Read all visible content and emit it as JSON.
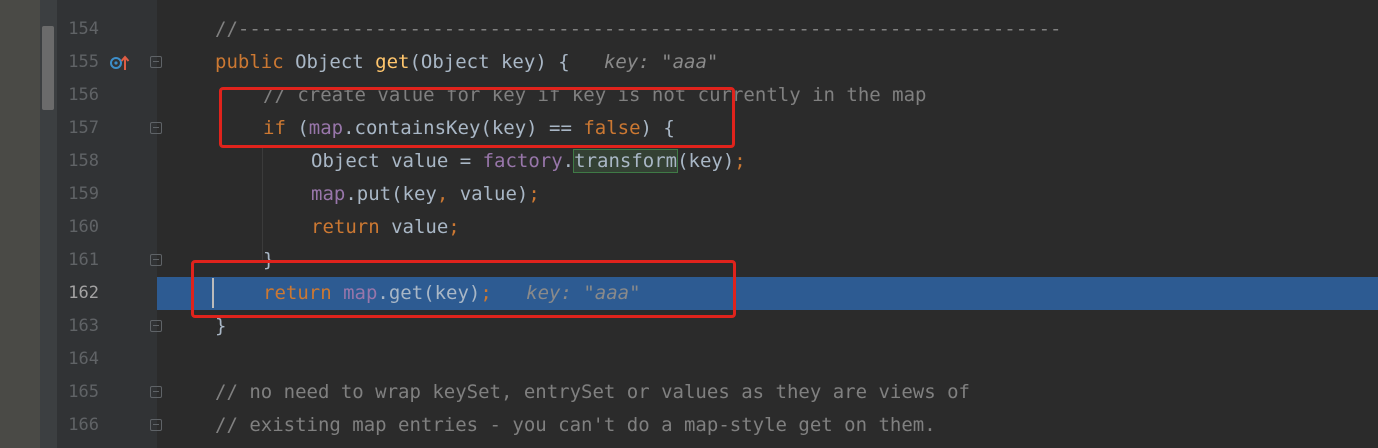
{
  "gutter": {
    "line_numbers": [
      "154",
      "155",
      "156",
      "157",
      "158",
      "159",
      "160",
      "161",
      "162",
      "163",
      "164",
      "165",
      "166"
    ]
  },
  "code": {
    "l154": "//------------------------------------------------------------------------",
    "l155_kw": "public",
    "l155_type": " Object ",
    "l155_fn": "get",
    "l155_rest": "(Object key) {",
    "l155_hint": "key: \"aaa\"",
    "l156": "// create value for key if key is not currently in the map",
    "l157_kw": "if",
    "l157_a": " (",
    "l157_field": "map",
    "l157_b": ".containsKey(key) == ",
    "l157_false": "false",
    "l157_c": ") {",
    "l158_a": "Object value = ",
    "l158_field": "factory",
    "l158_dot": ".",
    "l158_method": "transform",
    "l158_b": "(key)",
    "l158_semi": ";",
    "l159_field": "map",
    "l159_a": ".put(key",
    "l159_comma": ",",
    "l159_b": " value)",
    "l159_semi": ";",
    "l160_kw": "return",
    "l160_a": " value",
    "l160_semi": ";",
    "l161": "}",
    "l162_kw": "return",
    "l162_field": " map",
    "l162_a": ".get(key)",
    "l162_semi": ";",
    "l162_hint": "key: \"aaa\"",
    "l163": "}",
    "l165": "// no need to wrap keySet, entrySet or values as they are views of",
    "l166": "// existing map entries - you can't do a map-style get on them."
  },
  "icons": [
    "override-method-icon",
    "fold-icon"
  ],
  "colors": {
    "keyword": "#cc7832",
    "method": "#ffc66d",
    "field": "#9876aa",
    "comment": "#808080",
    "selection": "#2d5b92",
    "annotation_box": "#e0231c"
  }
}
